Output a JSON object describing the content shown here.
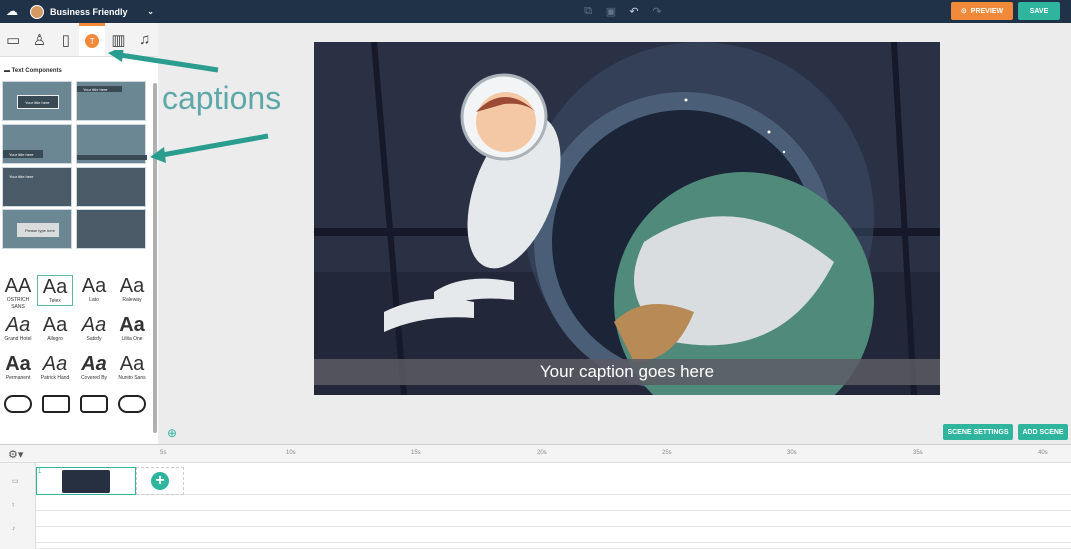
{
  "topbar": {
    "project_name": "Business Friendly",
    "preview_label": "PREVIEW",
    "save_label": "SAVE"
  },
  "panel": {
    "section_title": "Text Components",
    "tabs": [
      "image-icon",
      "character-icon",
      "device-icon",
      "text-icon",
      "chart-icon",
      "music-icon"
    ],
    "thumbs": [
      "Your title here",
      "Your title here",
      "Your title here",
      "",
      "Your title here",
      "",
      "Please type here",
      ""
    ],
    "fonts": [
      {
        "glyph": "AA",
        "name": "OSTRICH SANS"
      },
      {
        "glyph": "Aa",
        "name": "Telex"
      },
      {
        "glyph": "Aa",
        "name": "Lato"
      },
      {
        "glyph": "Aa",
        "name": "Raleway"
      },
      {
        "glyph": "Aa",
        "name": "Grand Hotel"
      },
      {
        "glyph": "Aa",
        "name": "Allegro"
      },
      {
        "glyph": "Aa",
        "name": "Satisfy"
      },
      {
        "glyph": "Aa",
        "name": "Lilita One"
      },
      {
        "glyph": "Aa",
        "name": "Permanent"
      },
      {
        "glyph": "Aa",
        "name": "Patrick Hand"
      },
      {
        "glyph": "Aa",
        "name": "Covered By"
      },
      {
        "glyph": "Aa",
        "name": "Nunito Sans"
      }
    ]
  },
  "annotation": {
    "text": "captions"
  },
  "canvas": {
    "caption": "Your caption goes here"
  },
  "scene": {
    "settings_label": "SCENE SETTINGS",
    "add_label": "ADD SCENE"
  },
  "timeline": {
    "ticks": [
      "5s",
      "10s",
      "15s",
      "20s",
      "25s",
      "30s",
      "35s",
      "40s"
    ],
    "clip_number": "1"
  }
}
